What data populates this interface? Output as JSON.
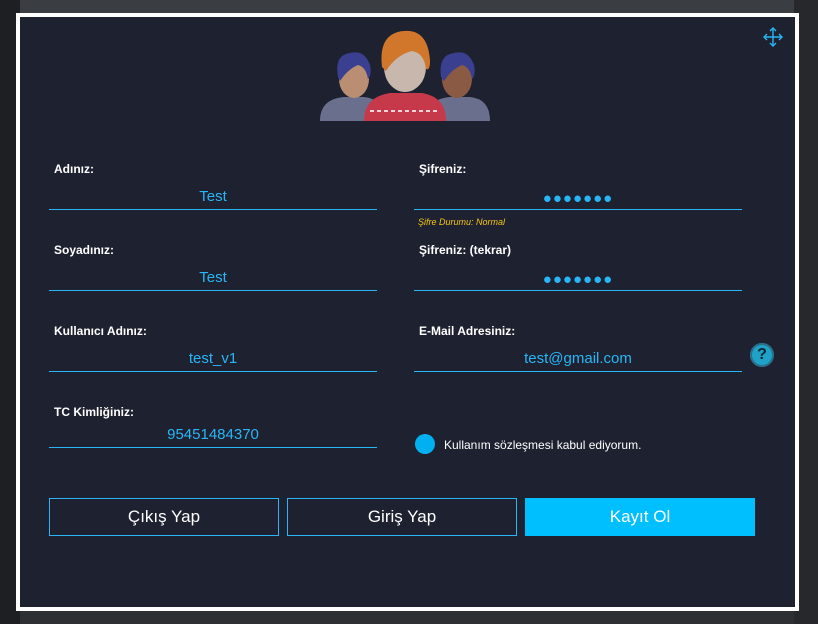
{
  "form": {
    "first_name": {
      "label": "Adınız:",
      "value": "Test"
    },
    "last_name": {
      "label": "Soyadınız:",
      "value": "Test"
    },
    "username": {
      "label": "Kullanıcı Adınız:",
      "value": "test_v1"
    },
    "tc_id": {
      "label": "TC Kimliğiniz:",
      "value": "95451484370"
    },
    "password": {
      "label": "Şifreniz:",
      "value": "●●●●●●●"
    },
    "password_repeat": {
      "label": "Şifreniz: (tekrar)",
      "value": "●●●●●●●"
    },
    "email": {
      "label": "E-Mail Adresiniz:",
      "value": "test@gmail.com"
    },
    "password_strength": "Şifre Durumu: Normal",
    "agreement_label": "Kullanım sözleşmesi kabul ediyorum."
  },
  "buttons": {
    "exit": "Çıkış Yap",
    "login": "Giriş Yap",
    "register": "Kayıt Ol"
  },
  "icons": {
    "move": "move-icon",
    "help": "help-icon",
    "help_glyph": "?",
    "avatar": "users-group-icon"
  },
  "colors": {
    "accent": "#29b6f6",
    "primary_button": "#00bfff",
    "background": "#1e2130",
    "warning": "#f5c518"
  }
}
